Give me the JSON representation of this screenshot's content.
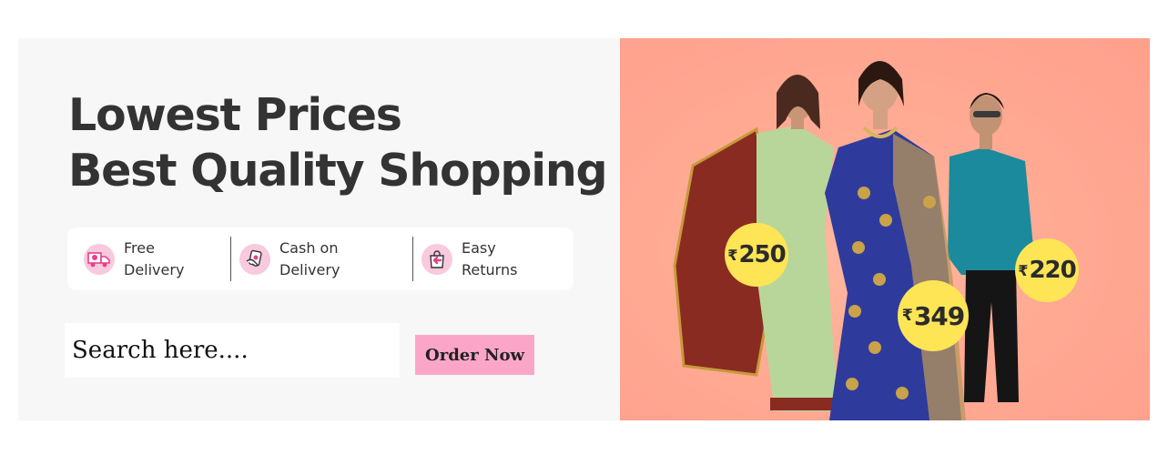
{
  "headline": {
    "line1": "Lowest Prices",
    "line2": "Best Quality Shopping"
  },
  "features": [
    {
      "label": "Free Delivery",
      "icon": "delivery-truck-icon"
    },
    {
      "label": "Cash on Delivery",
      "icon": "cash-hand-icon"
    },
    {
      "label": "Easy Returns",
      "icon": "return-bag-icon"
    }
  ],
  "search": {
    "placeholder": "Search here...."
  },
  "order_button": {
    "label": "Order Now"
  },
  "prices": [
    {
      "currency": "₹",
      "amount": "250"
    },
    {
      "currency": "₹",
      "amount": "349"
    },
    {
      "currency": "₹",
      "amount": "220"
    }
  ],
  "colors": {
    "accent_pink": "#fba6c8",
    "icon_pink": "#e83e8c",
    "price_badge": "#fde556",
    "hero_background": "#ffab94"
  }
}
